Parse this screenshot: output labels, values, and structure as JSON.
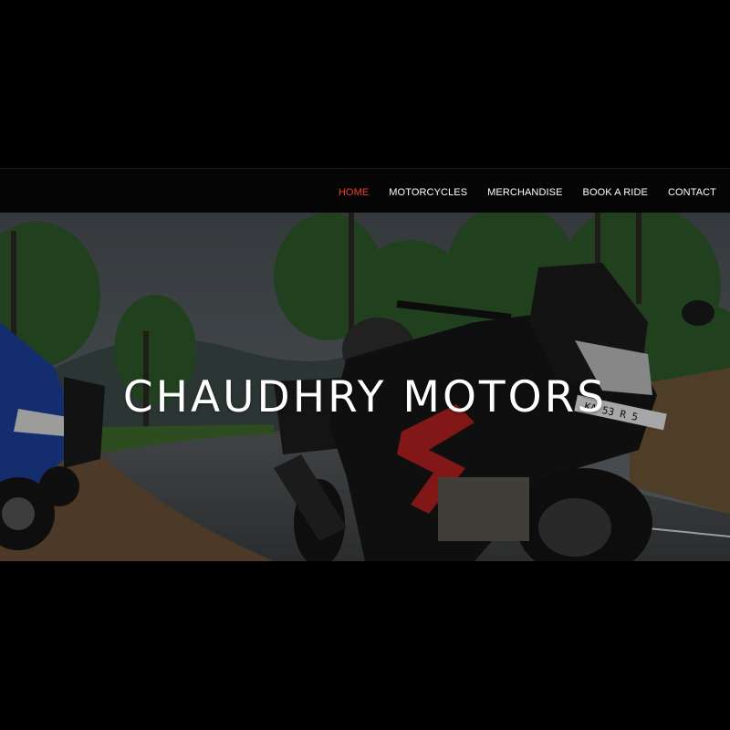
{
  "nav": {
    "items": [
      {
        "label": "HOME",
        "active": true
      },
      {
        "label": "MOTORCYCLES",
        "active": false
      },
      {
        "label": "MERCHANDISE",
        "active": false
      },
      {
        "label": "BOOK A RIDE",
        "active": false
      },
      {
        "label": "CONTACT",
        "active": false
      }
    ],
    "active_color": "#e8452c"
  },
  "hero": {
    "title": "CHAUDHRY MOTORS",
    "image": "motorcycles-on-mountain-road",
    "plate_text": "KA 53 R 5"
  }
}
